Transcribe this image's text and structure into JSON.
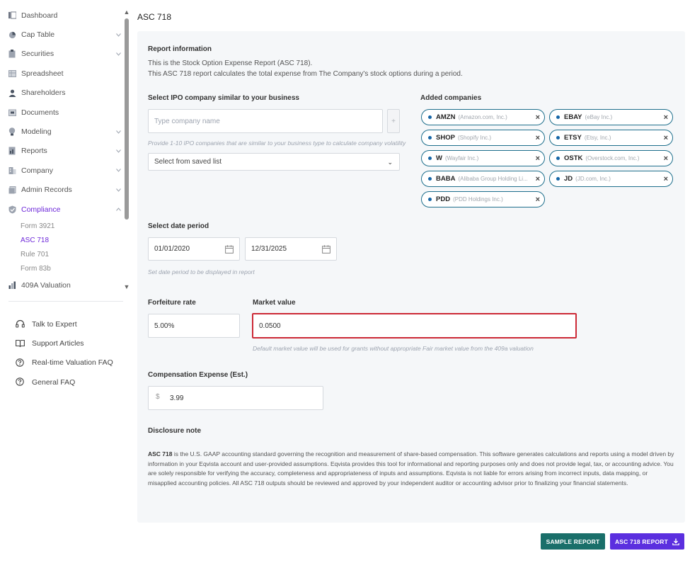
{
  "sidebar": {
    "items": [
      {
        "label": "Dashboard",
        "icon": "dashboard-icon",
        "chevron": false
      },
      {
        "label": "Cap Table",
        "icon": "pie-chart-icon",
        "chevron": true
      },
      {
        "label": "Securities",
        "icon": "clipboard-icon",
        "chevron": true
      },
      {
        "label": "Spreadsheet",
        "icon": "spreadsheet-icon",
        "chevron": false
      },
      {
        "label": "Shareholders",
        "icon": "user-icon",
        "chevron": false
      },
      {
        "label": "Documents",
        "icon": "folder-icon",
        "chevron": false
      },
      {
        "label": "Modeling",
        "icon": "bulb-icon",
        "chevron": true
      },
      {
        "label": "Reports",
        "icon": "report-icon",
        "chevron": true
      },
      {
        "label": "Company",
        "icon": "building-icon",
        "chevron": true
      },
      {
        "label": "Admin Records",
        "icon": "records-icon",
        "chevron": true
      },
      {
        "label": "Compliance",
        "icon": "shield-check-icon",
        "chevron": true,
        "active": true
      }
    ],
    "compliance_sub": [
      "Form 3921",
      "ASC 718",
      "Rule 701",
      "Form 83b"
    ],
    "active_sub": "ASC 718",
    "valuation_label": "409A Valuation",
    "help_items": [
      {
        "label": "Talk to Expert",
        "icon": "headset-icon"
      },
      {
        "label": "Support Articles",
        "icon": "book-icon"
      },
      {
        "label": "Real-time Valuation FAQ",
        "icon": "help-circle-icon"
      },
      {
        "label": "General FAQ",
        "icon": "help-circle-icon"
      }
    ]
  },
  "page": {
    "title": "ASC 718"
  },
  "report_info": {
    "title": "Report information",
    "line1": "This is the Stock Option Expense Report (ASC 718).",
    "line2": "This ASC 718 report calculates the total expense from The Company's stock options during a period."
  },
  "ipo": {
    "title": "Select IPO company similar to your business",
    "placeholder": "Type company name",
    "plus": "+",
    "hint": "Provide 1-10 IPO companies that are similar to your business type to calculate company volatility",
    "saved_list": "Select from saved list"
  },
  "added": {
    "title": "Added companies",
    "companies": [
      {
        "ticker": "AMZN",
        "name": "(Amazon.com, Inc.)"
      },
      {
        "ticker": "EBAY",
        "name": "(eBay Inc.)"
      },
      {
        "ticker": "SHOP",
        "name": "(Shopify Inc.)"
      },
      {
        "ticker": "ETSY",
        "name": "(Etsy, Inc.)"
      },
      {
        "ticker": "W",
        "name": "(Wayfair Inc.)"
      },
      {
        "ticker": "OSTK",
        "name": "(Overstock.com, Inc.)"
      },
      {
        "ticker": "BABA",
        "name": "(Alibaba Group Holding Li..."
      },
      {
        "ticker": "JD",
        "name": "(JD.com, Inc.)"
      },
      {
        "ticker": "PDD",
        "name": "(PDD Holdings Inc.)"
      }
    ]
  },
  "date_period": {
    "title": "Select date period",
    "start": "01/01/2020",
    "end": "12/31/2025",
    "hint": "Set date period to be displayed in report"
  },
  "forfeiture": {
    "title": "Forfeiture rate",
    "value": "5.00%"
  },
  "market": {
    "title": "Market value",
    "value": "0.0500",
    "hint": "Default market value will be used for grants without appropriate Fair market value from the 409a valuation"
  },
  "compensation": {
    "title": "Compensation Expense (Est.)",
    "currency": "$",
    "value": "3.99"
  },
  "disclosure": {
    "title": "Disclosure note",
    "bold": "ASC 718",
    "text": " is the U.S. GAAP accounting standard governing the recognition and measurement of share-based compensation. This software generates calculations and reports using a model driven by information in your Eqvista account and user-provided assumptions. Eqvista provides this tool for informational and reporting purposes only and does not provide legal, tax, or accounting advice. You are solely responsible for verifying the accuracy, completeness and appropriateness of inputs and assumptions. Eqvista is not liable for errors arising from incorrect inputs, data mapping, or misapplied accounting policies. All ASC 718 outputs should be reviewed and approved by your independent auditor or accounting advisor prior to finalizing your financial statements."
  },
  "buttons": {
    "sample": "SAMPLE REPORT",
    "report": "ASC 718 REPORT"
  },
  "colors": {
    "accent": "#6d28d9",
    "chip_border": "#1e6f8c",
    "highlight": "#cc2936",
    "sample_btn": "#1a6f6a",
    "report_btn": "#5b2fdf"
  }
}
